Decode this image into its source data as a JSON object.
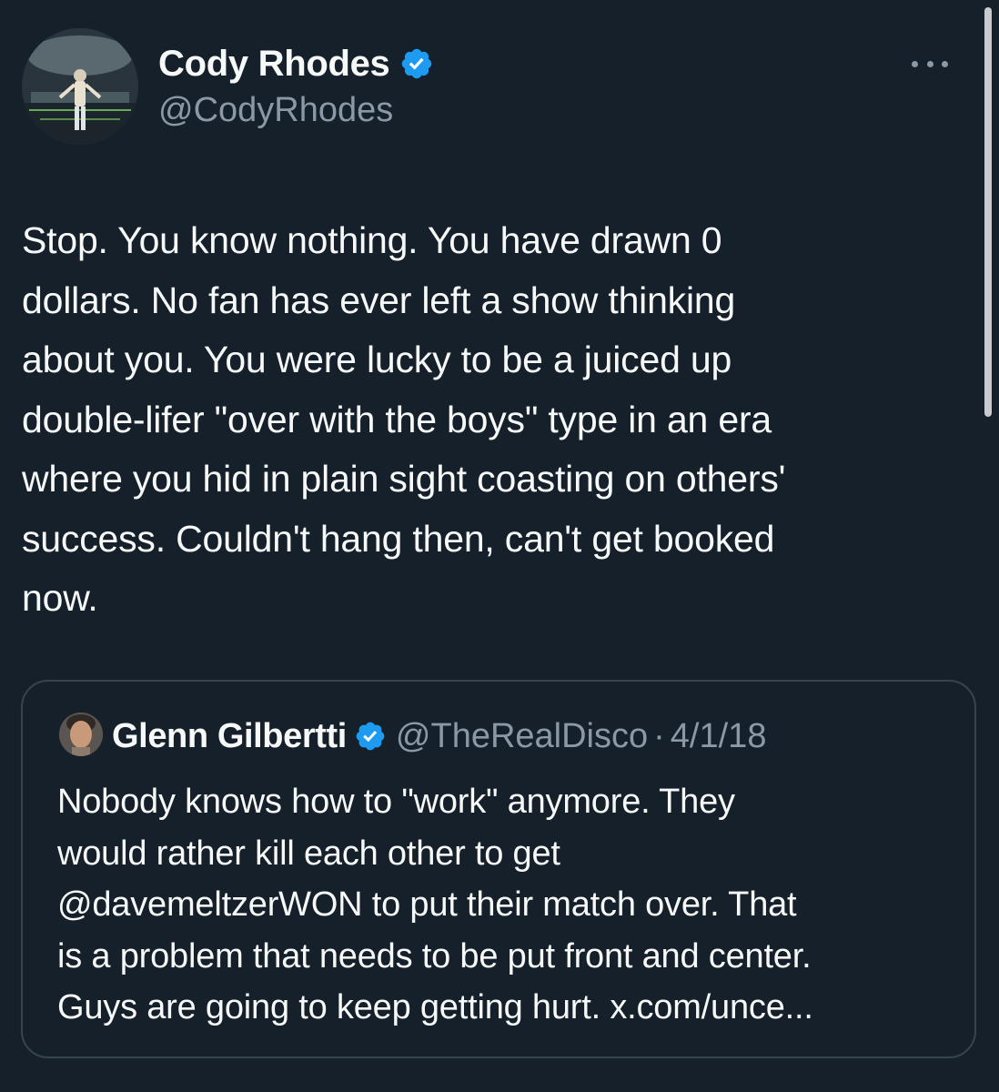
{
  "tweet": {
    "author": {
      "display_name": "Cody Rhodes",
      "handle": "@CodyRhodes",
      "verified": true
    },
    "text_lines": [
      "Stop. You know nothing. You have drawn 0",
      "dollars. No fan has ever left a show thinking",
      "about you. You were lucky to be a juiced up",
      "double-lifer \"over with the boys\" type in an era",
      "where you hid in plain sight coasting on others'",
      "success. Couldn't hang then, can't get booked",
      "now."
    ]
  },
  "quoted_tweet": {
    "author": {
      "display_name": "Glenn Gilbertti",
      "handle": "@TheRealDisco",
      "verified": true
    },
    "separator": "·",
    "date": "4/1/18",
    "text_lines": [
      "Nobody knows how to \"work\" anymore.  They",
      "would rather kill each other to get",
      "@davemeltzerWON to put their match over.  That",
      "is a problem that needs to be put front and center.",
      "Guys are going to keep getting hurt. x.com/unce..."
    ]
  },
  "colors": {
    "background": "#15202b",
    "text": "#f7f9f9",
    "secondary_text": "#8b98a5",
    "verified_blue": "#1d9bf0",
    "border": "#38444d"
  },
  "icons": {
    "verified": "verified-badge-icon",
    "more": "more-options-icon"
  }
}
